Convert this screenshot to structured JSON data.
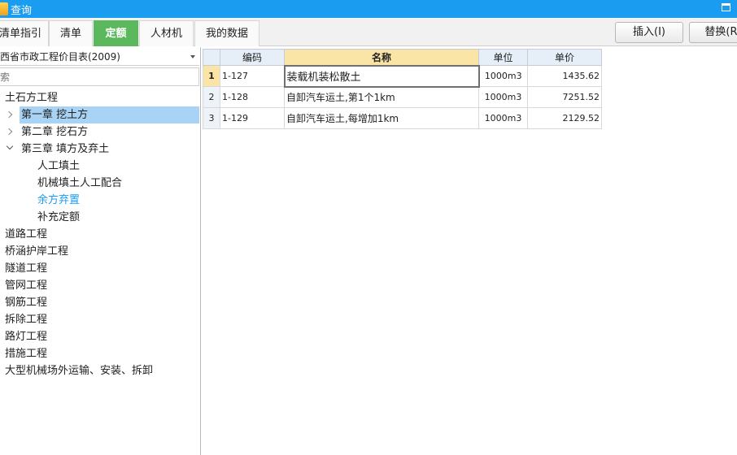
{
  "window": {
    "title": "查询"
  },
  "tabs": [
    {
      "label": "清单指引"
    },
    {
      "label": "清单"
    },
    {
      "label": "定额",
      "active": true
    },
    {
      "label": "人材机"
    },
    {
      "label": "我的数据"
    }
  ],
  "toolbar": {
    "insert_label": "插入(I)",
    "replace_label": "替换(R)"
  },
  "catalog": {
    "selected": "西省市政工程价目表(2009)"
  },
  "search": {
    "placeholder": "索"
  },
  "tree": [
    {
      "label": "土石方工程"
    },
    {
      "label": "第一章 挖土方"
    },
    {
      "label": "第二章 挖石方"
    },
    {
      "label": "第三章 填方及弃土"
    },
    {
      "label": "人工填土"
    },
    {
      "label": "机械填土人工配合"
    },
    {
      "label": "余方弃置"
    },
    {
      "label": "补充定额"
    },
    {
      "label": "道路工程"
    },
    {
      "label": "桥涵护岸工程"
    },
    {
      "label": "隧道工程"
    },
    {
      "label": "管网工程"
    },
    {
      "label": "钢筋工程"
    },
    {
      "label": "拆除工程"
    },
    {
      "label": "路灯工程"
    },
    {
      "label": "措施工程"
    },
    {
      "label": "大型机械场外运输、安装、拆卸"
    }
  ],
  "table": {
    "headers": {
      "code": "编码",
      "name": "名称",
      "unit": "单位",
      "price": "单价"
    },
    "rows": [
      {
        "no": "1",
        "code": "1-127",
        "name": "装载机装松散土",
        "unit": "1000m3",
        "price": "1435.62"
      },
      {
        "no": "2",
        "code": "1-128",
        "name": "自卸汽车运土,第1个1km",
        "unit": "1000m3",
        "price": "7251.52"
      },
      {
        "no": "3",
        "code": "1-129",
        "name": "自卸汽车运土,每增加1km",
        "unit": "1000m3",
        "price": "2129.52"
      }
    ]
  },
  "colors": {
    "titlebar": "#1a9cf0",
    "active_tab": "#5cb85c",
    "selected_node": "#a9d3f5",
    "link_node": "#1a9cf0",
    "name_header": "#fbe5a6"
  }
}
